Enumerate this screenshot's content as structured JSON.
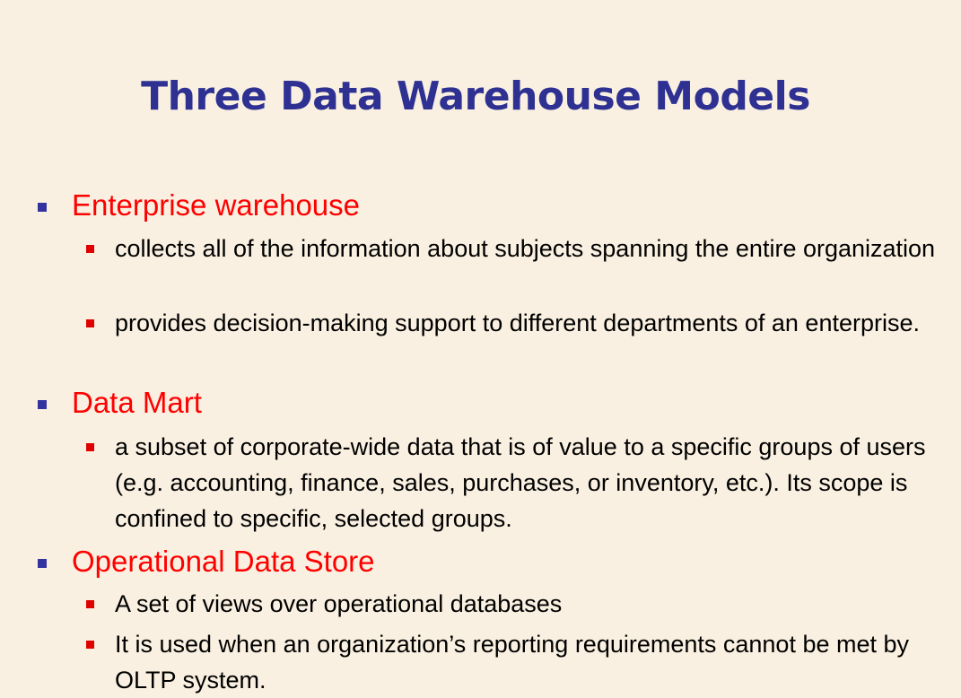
{
  "slide": {
    "title": "Three Data Warehouse Models",
    "sections": [
      {
        "heading": "Enterprise warehouse",
        "items": [
          "collects all of the information about subjects spanning the entire organization",
          "provides decision-making support to different departments of an enterprise."
        ]
      },
      {
        "heading": "Data Mart",
        "items": [
          "a subset of corporate-wide data that is of value to a specific groups of users (e.g. accounting, finance, sales, purchases, or inventory, etc.).  Its scope is confined to specific, selected groups."
        ]
      },
      {
        "heading": "Operational Data Store",
        "items": [
          "A set of views over operational databases",
          "It is used when an organization’s reporting requirements cannot be met by OLTP system."
        ]
      }
    ]
  },
  "colors": {
    "background": "#f9f0e1",
    "title": "#2e3192",
    "heading": "#ff0000",
    "level1_bullet": "#3333a0",
    "level2_bullet": "#e00000",
    "body_text": "#000000"
  }
}
